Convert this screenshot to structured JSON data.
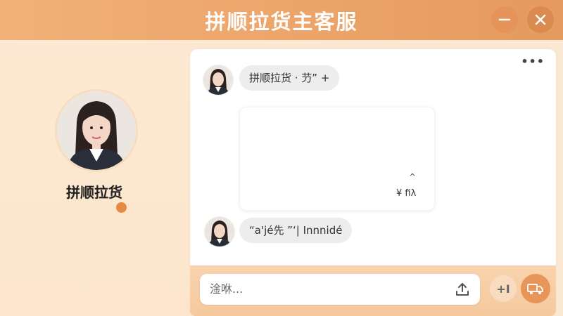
{
  "window": {
    "title": "拼顺拉货主客服",
    "minimize_icon": "minimize-icon",
    "close_icon": "close-icon"
  },
  "agent": {
    "name": "拼顺拉货",
    "status_color": "#e48a44"
  },
  "chat": {
    "more_label": "•••",
    "messages": [
      {
        "text": "拼顺拉货 · 芀” +"
      },
      {
        "card": {
          "arrow": "^",
          "price": "¥ fiλ"
        }
      },
      {
        "text": "“a'jé先  ”ʻ| Innnidé"
      }
    ]
  },
  "input": {
    "placeholder": "淦咻...",
    "upload_icon": "upload-icon",
    "add_label": "+I",
    "send_icon": "truck-icon"
  },
  "colors": {
    "accent": "#e8955a",
    "title_bar": "#eda56a",
    "panel_bg": "#fde9d3"
  }
}
